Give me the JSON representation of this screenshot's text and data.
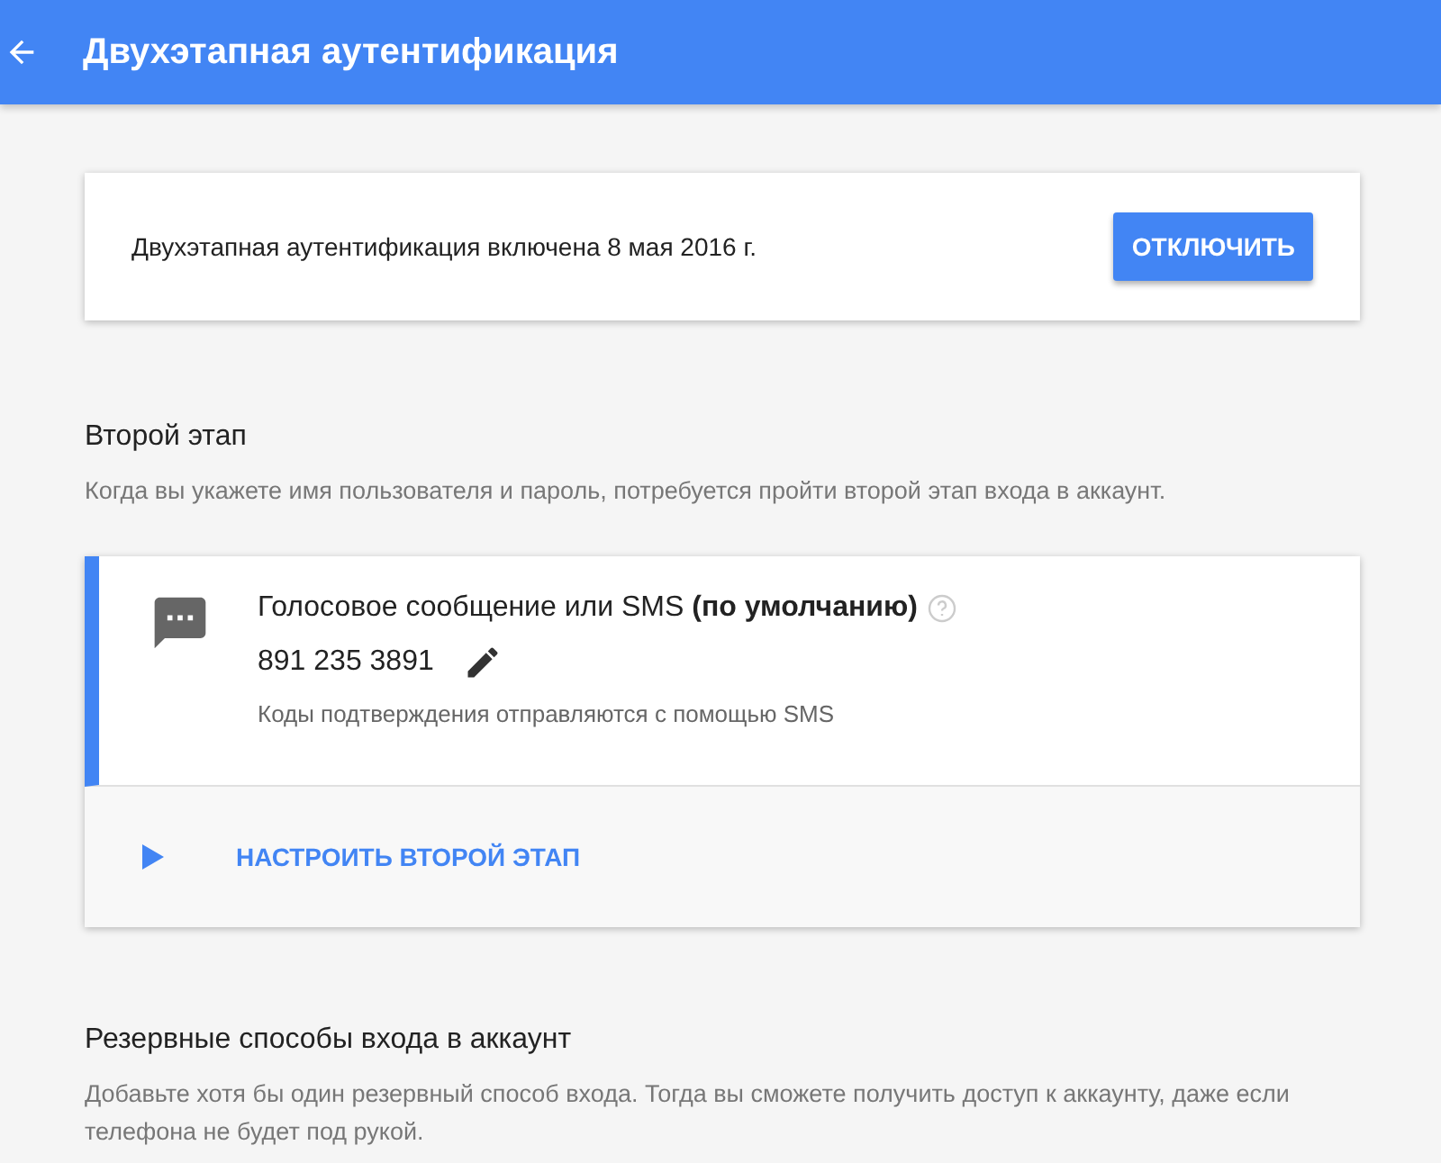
{
  "header": {
    "title": "Двухэтапная аутентификация"
  },
  "status_card": {
    "text": "Двухэтапная аутентификация включена 8 мая 2016 г.",
    "button": "ОТКЛЮЧИТЬ"
  },
  "second_step": {
    "title": "Второй этап",
    "description": "Когда вы укажете имя пользователя и пароль, потребуется пройти второй этап входа в аккаунт.",
    "method": {
      "title": "Голосовое сообщение или SMS **(по умолчанию)**",
      "phone": "891 235 3891",
      "note": "Коды подтверждения отправляются с помощью SMS"
    },
    "setup_link": "НАСТРОИТЬ ВТОРОЙ ЭТАП"
  },
  "backup": {
    "title": "Резервные способы входа в аккаунт",
    "description": "Добавьте хотя бы один резервный способ входа. Тогда вы сможете получить доступ к аккаунту, даже если телефона не будет под рукой."
  }
}
